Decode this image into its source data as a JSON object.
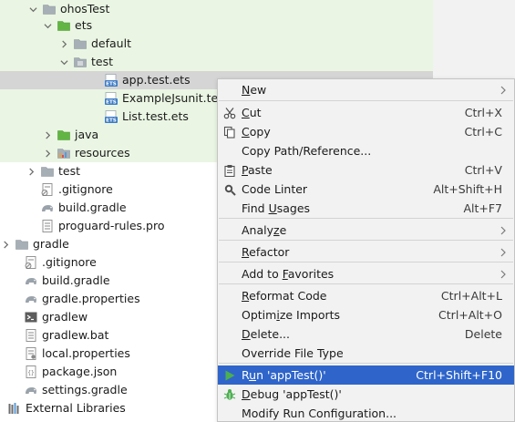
{
  "tree": {
    "items": [
      {
        "label": "ohosTest"
      },
      {
        "label": "ets"
      },
      {
        "label": "default"
      },
      {
        "label": "test"
      },
      {
        "label": "app.test.ets"
      },
      {
        "label": "ExampleJsunit.test.ets"
      },
      {
        "label": "List.test.ets"
      },
      {
        "label": "java"
      },
      {
        "label": "resources"
      },
      {
        "label": "test"
      },
      {
        "label": ".gitignore"
      },
      {
        "label": "build.gradle"
      },
      {
        "label": "proguard-rules.pro"
      },
      {
        "label": "gradle"
      },
      {
        "label": ".gitignore"
      },
      {
        "label": "build.gradle"
      },
      {
        "label": "gradle.properties"
      },
      {
        "label": "gradlew"
      },
      {
        "label": "gradlew.bat"
      },
      {
        "label": "local.properties"
      },
      {
        "label": "package.json"
      },
      {
        "label": "settings.gradle"
      },
      {
        "label": "External Libraries"
      }
    ]
  },
  "menu": {
    "items": [
      {
        "label": "New",
        "shortcut": "",
        "icon": ""
      },
      {
        "label": "Cut",
        "shortcut": "Ctrl+X",
        "icon": "scissors-icon"
      },
      {
        "label": "Copy",
        "shortcut": "Ctrl+C",
        "icon": "copy-icon"
      },
      {
        "label": "Copy Path/Reference...",
        "shortcut": "",
        "icon": ""
      },
      {
        "label": "Paste",
        "shortcut": "Ctrl+V",
        "icon": "clipboard-icon"
      },
      {
        "label": "Code Linter",
        "shortcut": "Alt+Shift+H",
        "icon": "linter-icon"
      },
      {
        "label": "Find Usages",
        "shortcut": "Alt+F7",
        "icon": ""
      },
      {
        "label": "Analyze",
        "shortcut": "",
        "icon": ""
      },
      {
        "label": "Refactor",
        "shortcut": "",
        "icon": ""
      },
      {
        "label": "Add to Favorites",
        "shortcut": "",
        "icon": ""
      },
      {
        "label": "Reformat Code",
        "shortcut": "Ctrl+Alt+L",
        "icon": ""
      },
      {
        "label": "Optimize Imports",
        "shortcut": "Ctrl+Alt+O",
        "icon": ""
      },
      {
        "label": "Delete...",
        "shortcut": "Delete",
        "icon": ""
      },
      {
        "label": "Override File Type",
        "shortcut": "",
        "icon": ""
      },
      {
        "label": "Run 'appTest()'",
        "shortcut": "Ctrl+Shift+F10",
        "icon": "run-icon"
      },
      {
        "label": "Debug 'appTest()'",
        "shortcut": "",
        "icon": "debug-icon"
      },
      {
        "label": "Modify Run Configuration...",
        "shortcut": "",
        "icon": ""
      }
    ]
  },
  "colors": {
    "highlight": "#2f65ca",
    "test_source_bg": "#eaf6e3",
    "selected_row": "#d5d5d5",
    "run_green": "#4caf50"
  }
}
